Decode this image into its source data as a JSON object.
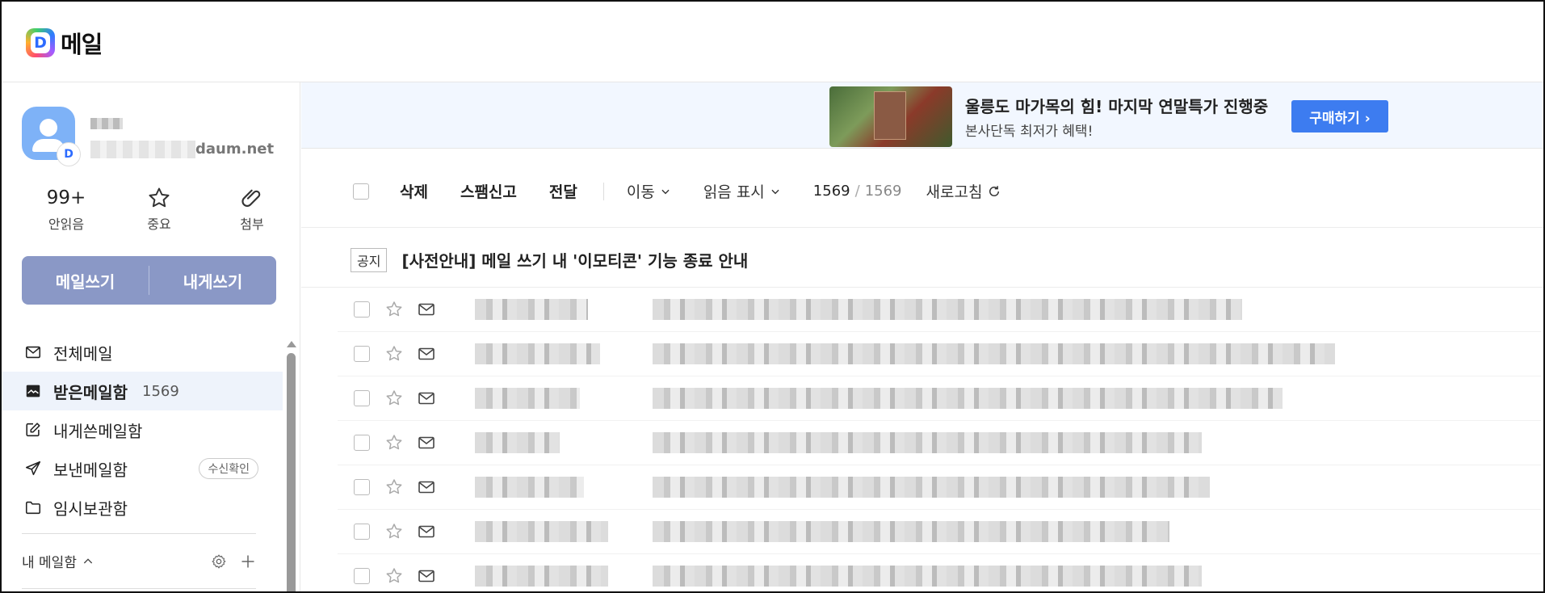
{
  "app": {
    "logo_text": "메일",
    "logo_badge": "D"
  },
  "account": {
    "email_domain": "daum.net",
    "avatar_badge": "D"
  },
  "stats": [
    {
      "value": "99+",
      "label": "안읽음"
    },
    {
      "label": "중요",
      "icon": "star-icon"
    },
    {
      "label": "첨부",
      "icon": "paperclip-icon"
    }
  ],
  "compose": {
    "write_label": "메일쓰기",
    "self_label": "내게쓰기"
  },
  "folders": [
    {
      "label": "전체메일",
      "icon": "envelope-icon"
    },
    {
      "label": "받은메일함",
      "count": "1569",
      "icon": "inbox-icon"
    },
    {
      "label": "내게쓴메일함",
      "icon": "edit-icon"
    },
    {
      "label": "보낸메일함",
      "icon": "send-icon",
      "pill": "수신확인"
    },
    {
      "label": "임시보관함",
      "icon": "folder-icon"
    }
  ],
  "mymail": {
    "label": "내 메일함"
  },
  "ad": {
    "title": "울릉도 마가목의 힘! 마지막 연말특가 진행중",
    "subtitle": "본사단독 최저가 혜택!",
    "button": "구매하기"
  },
  "toolbar": {
    "delete": "삭제",
    "spam": "스팸신고",
    "forward": "전달",
    "move": "이동",
    "mark_read": "읽음 표시",
    "count": "1569",
    "total": "1569",
    "refresh": "새로고침"
  },
  "notice": {
    "tag": "공지",
    "text": "[사전안내] 메일 쓰기 내 '이모티콘' 기능 종료 안내"
  },
  "colors": {
    "accent": "#3d7cf0",
    "compose_bg": "#8a98c6",
    "ad_bg": "#f2f7ff",
    "active_folder_bg": "#eef3fb"
  }
}
